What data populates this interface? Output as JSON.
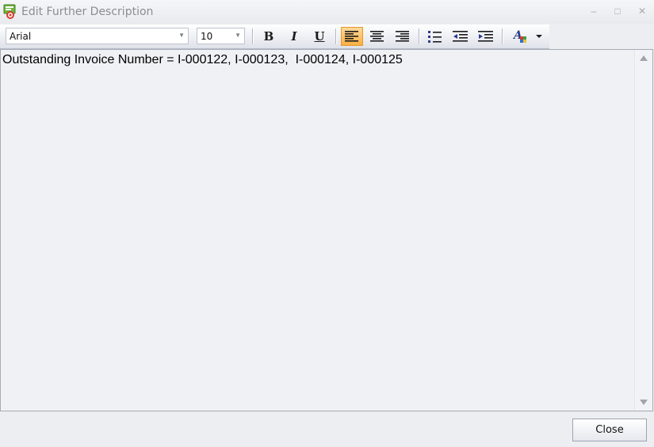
{
  "window": {
    "title": "Edit Further Description",
    "controls": {
      "minimize": "–",
      "maximize": "□",
      "close": "✕"
    }
  },
  "toolbar": {
    "font_family": "Arial",
    "font_size": "10",
    "buttons": [
      {
        "name": "bold",
        "label": "B"
      },
      {
        "name": "italic",
        "label": "I"
      },
      {
        "name": "underline",
        "label": "U"
      },
      {
        "name": "align-left",
        "active": true
      },
      {
        "name": "align-center"
      },
      {
        "name": "align-right"
      },
      {
        "name": "bullets"
      },
      {
        "name": "outdent"
      },
      {
        "name": "indent"
      },
      {
        "name": "font-color"
      }
    ]
  },
  "editor": {
    "content": "Outstanding Invoice Number = I-000122, I-000123,  I-000124, I-000125"
  },
  "footer": {
    "close_label": "Close"
  },
  "colors": {
    "active_button": "#fbb042",
    "title_text": "#8a8d93"
  }
}
